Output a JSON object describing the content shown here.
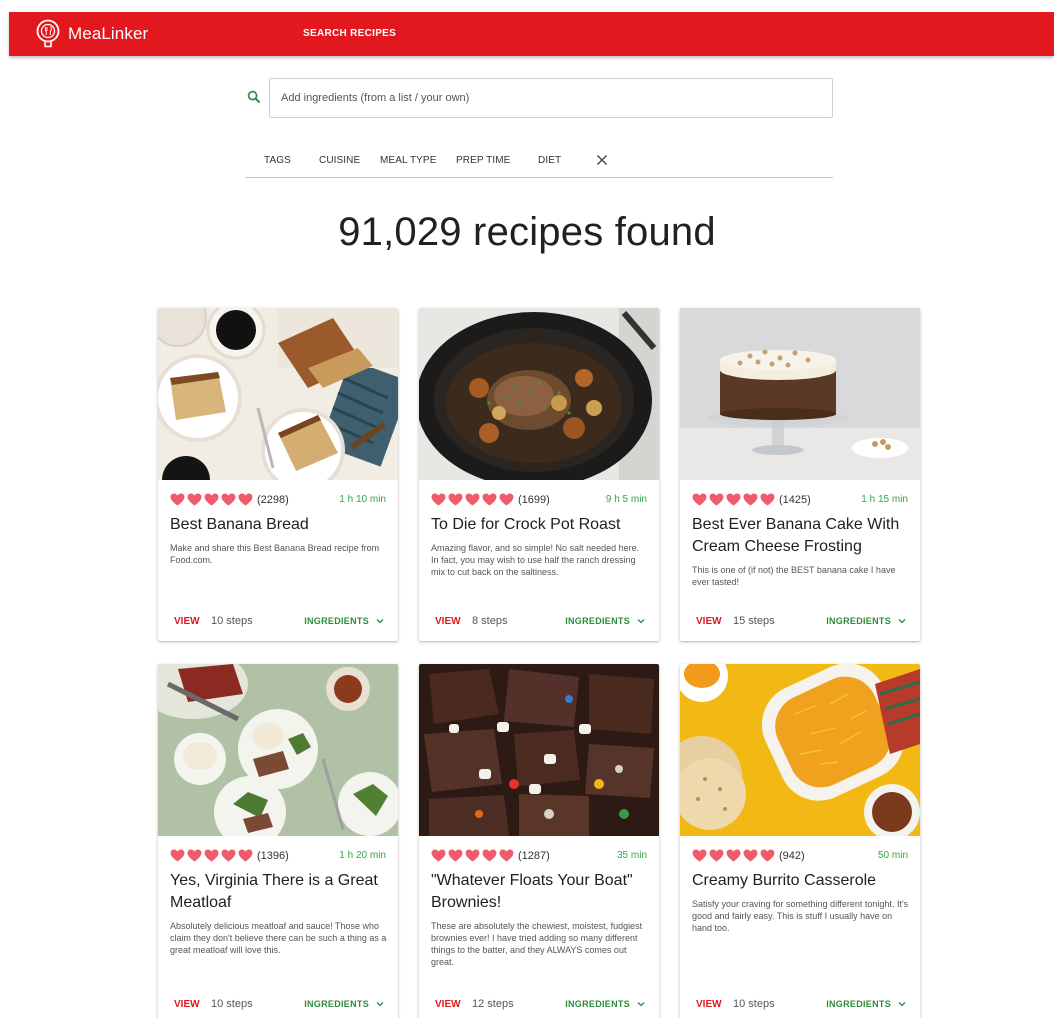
{
  "app": {
    "brand": "MeaLinker",
    "nav": "SEARCH RECIPES"
  },
  "search": {
    "placeholder": "Add ingredients (from a list / your own)"
  },
  "filters": [
    "TAGS",
    "CUISINE",
    "MEAL TYPE",
    "PREP TIME",
    "DIET"
  ],
  "results": {
    "title": "91,029 recipes found"
  },
  "colors": {
    "brand": "#e2181e",
    "heart": "#f05a6a",
    "time": "#2eaa3a",
    "ingredients": "#2e8b3a"
  },
  "recipes": [
    {
      "title": "Best Banana Bread",
      "rating": 5,
      "count": "(2298)",
      "time": "1 h 10 min",
      "description": "Make and share this Best Banana Bread recipe from Food.com.",
      "view": "VIEW",
      "steps": "10 steps",
      "ingredients": "INGREDIENTS",
      "image": "banana-bread-photo"
    },
    {
      "title": "To Die for Crock Pot Roast",
      "rating": 5,
      "count": "(1699)",
      "time": "9 h 5 min",
      "description": "Amazing flavor, and so simple! No salt needed here. In fact, you may wish to use half the ranch dressing mix to cut back on the saltiness.",
      "view": "VIEW",
      "steps": "8 steps",
      "ingredients": "INGREDIENTS",
      "image": "crock-pot-roast-photo"
    },
    {
      "title": "Best Ever Banana Cake With Cream Cheese Frosting",
      "rating": 5,
      "count": "(1425)",
      "time": "1 h 15 min",
      "description": "This is one of (if not) the BEST banana cake I have ever tasted!",
      "view": "VIEW",
      "steps": "15 steps",
      "ingredients": "INGREDIENTS",
      "image": "banana-cake-photo"
    },
    {
      "title": "Yes, Virginia There is a Great Meatloaf",
      "rating": 5,
      "count": "(1396)",
      "time": "1 h 20 min",
      "description": "Absolutely delicious meatloaf and sauce! Those who claim they don't believe there can be such a thing as a great meatloaf will love this.",
      "view": "VIEW",
      "steps": "10 steps",
      "ingredients": "INGREDIENTS",
      "image": "meatloaf-photo"
    },
    {
      "title": "\"Whatever Floats Your Boat\" Brownies!",
      "rating": 5,
      "count": "(1287)",
      "time": "35 min",
      "description": "These are absolutely the chewiest, moistest, fudgiest brownies ever! I have tried adding so many different things to the batter, and they ALWAYS comes out great.",
      "view": "VIEW",
      "steps": "12 steps",
      "ingredients": "INGREDIENTS",
      "image": "brownies-photo"
    },
    {
      "title": "Creamy Burrito Casserole",
      "rating": 5,
      "count": "(942)",
      "time": "50 min",
      "description": "Satisfy your craving for something different tonight. It's good and fairly easy. This is stuff I usually have on hand too.",
      "view": "VIEW",
      "steps": "10 steps",
      "ingredients": "INGREDIENTS",
      "image": "burrito-casserole-photo"
    }
  ]
}
